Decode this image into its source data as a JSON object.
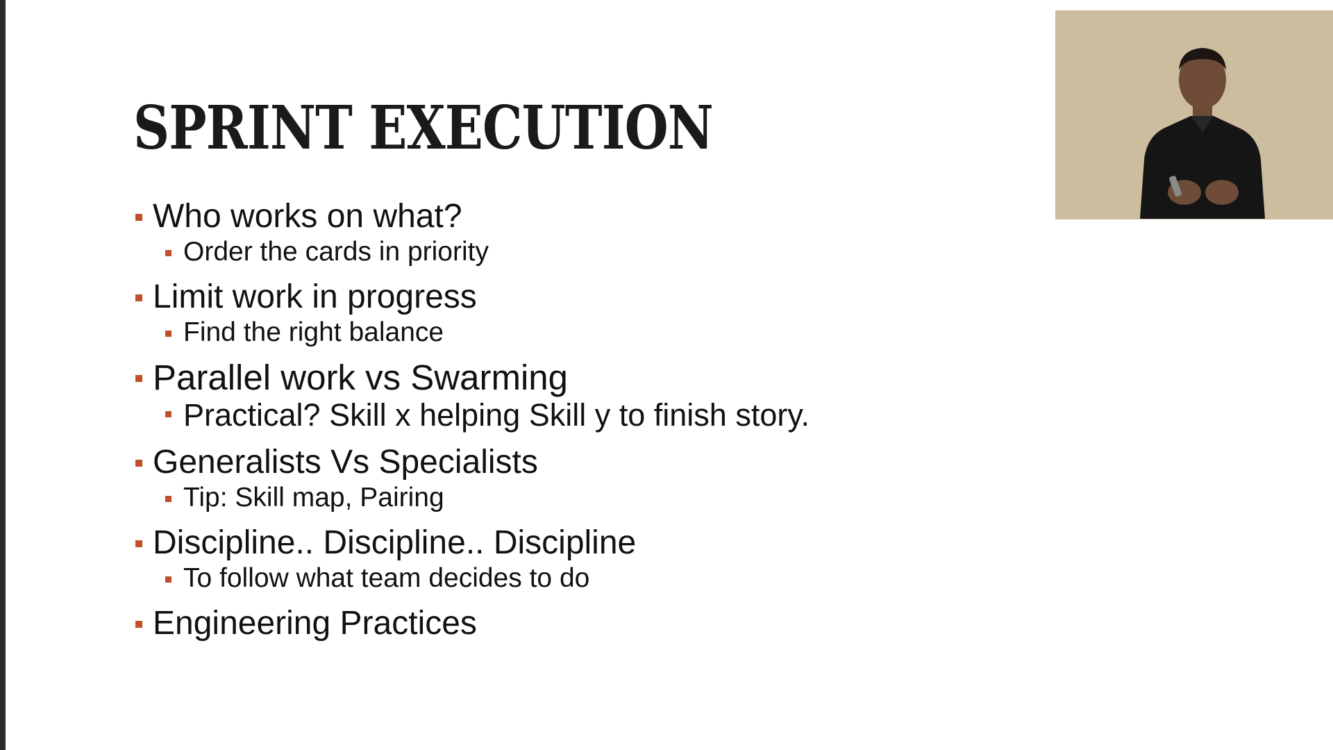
{
  "slide": {
    "title": "SPRINT EXECUTION",
    "bullets": [
      {
        "text": "Who works on what?",
        "sub": "Order the cards in priority"
      },
      {
        "text": "Limit work in progress",
        "sub": "Find the right balance"
      },
      {
        "text": "Parallel work vs Swarming",
        "sub": "Practical? Skill x helping Skill y to finish story."
      },
      {
        "text": "Generalists Vs Specialists",
        "sub": "Tip: Skill map, Pairing"
      },
      {
        "text": "Discipline.. Discipline.. Discipline",
        "sub": "To follow what team decides to do"
      },
      {
        "text": "Engineering Practices"
      }
    ]
  },
  "colors": {
    "bullet_accent": "#c0502a",
    "left_bar": "#2b2b2b",
    "webcam_wall": "#c8b998",
    "presenter_shirt": "#151515"
  },
  "webcam": {
    "icon": "presenter-video-icon"
  }
}
